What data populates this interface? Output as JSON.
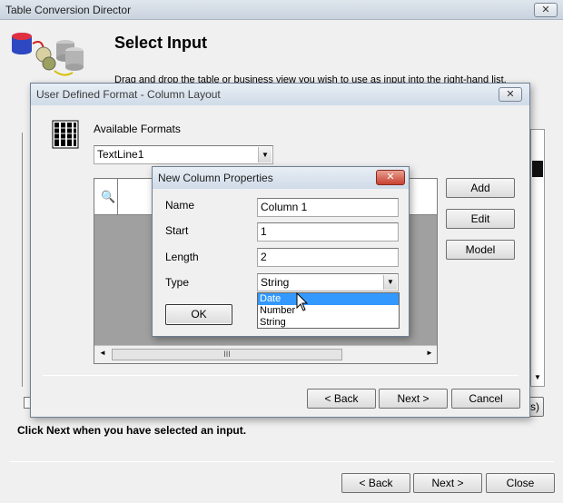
{
  "main_window": {
    "title": "Table Conversion Director",
    "heading": "Select Input",
    "description": "Drag and drop the table or business view you wish to use as input into the right-hand list.",
    "hint": "Click Next when you have selected an input.",
    "back_label": "< Back",
    "next_label": "Next >",
    "close_label": "Close",
    "partial_button_label": "s)"
  },
  "udf_dialog": {
    "title": "User Defined Format - Column Layout",
    "available_formats_label": "Available Formats",
    "format_value": "TextLine1",
    "add_label": "Add",
    "edit_label": "Edit",
    "model_label": "Model",
    "back_label": "< Back",
    "next_label": "Next >",
    "cancel_label": "Cancel",
    "hscroll_grip": "III"
  },
  "ncp_dialog": {
    "title": "New Column Properties",
    "name_label": "Name",
    "name_value": "Column 1",
    "start_label": "Start",
    "start_value": "1",
    "length_label": "Length",
    "length_value": "2",
    "type_label": "Type",
    "type_value": "String",
    "type_options": [
      "Date",
      "Number",
      "String"
    ],
    "highlighted_option": "Date",
    "ok_label": "OK"
  },
  "colors": {
    "selection": "#3399ff",
    "dialog_title_text": "#1e1e1e",
    "grid_gray": "#a0a0a0"
  },
  "icons": [
    "close-icon",
    "database-transfer-icon",
    "column-layout-icon",
    "search-column-icon",
    "dropdown-arrow-icon",
    "mouse-cursor-icon"
  ]
}
